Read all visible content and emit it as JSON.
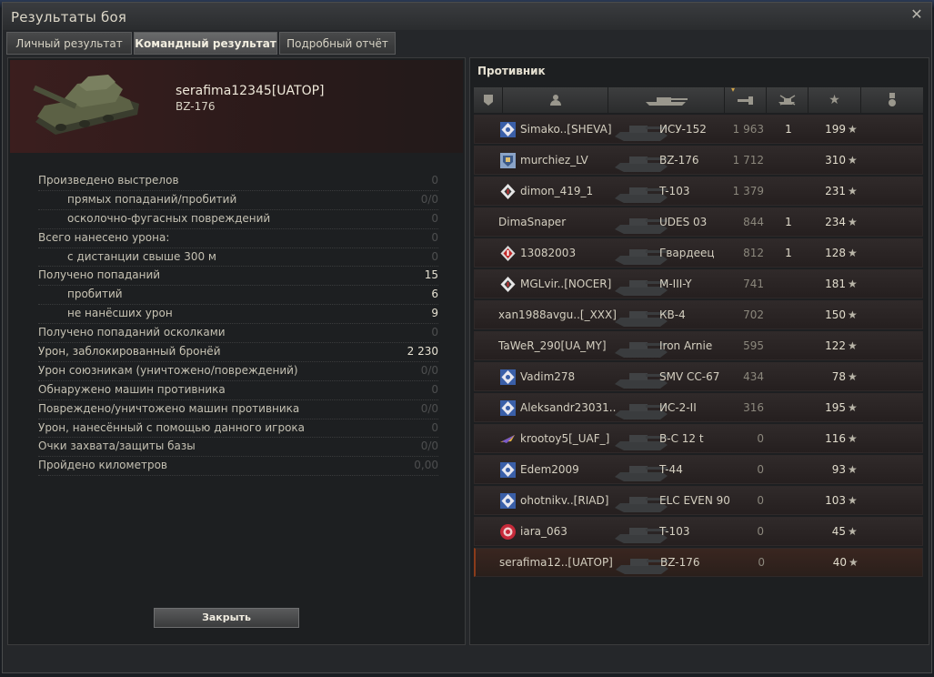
{
  "window": {
    "title": "Результаты боя",
    "close_symbol": "✕"
  },
  "tabs": [
    {
      "label": "Личный результат",
      "active": false
    },
    {
      "label": "Командный результат",
      "active": true
    },
    {
      "label": "Подробный отчёт",
      "active": false
    }
  ],
  "player": {
    "name": "serafima12345[UATOP]",
    "tank": "BZ-176"
  },
  "stats": [
    {
      "label": "Произведено выстрелов",
      "value": "0",
      "indent": false,
      "dim": true
    },
    {
      "label": "прямых попаданий/пробитий",
      "value": "0/0",
      "indent": true,
      "dim": true
    },
    {
      "label": "осколочно-фугасных повреждений",
      "value": "0",
      "indent": true,
      "dim": true
    },
    {
      "label": "Всего нанесено урона:",
      "value": "0",
      "indent": false,
      "dim": true
    },
    {
      "label": "с дистанции свыше 300 м",
      "value": "0",
      "indent": true,
      "dim": true
    },
    {
      "label": "Получено попаданий",
      "value": "15",
      "indent": false,
      "dim": false
    },
    {
      "label": "пробитий",
      "value": "6",
      "indent": true,
      "dim": false
    },
    {
      "label": "не нанёсших урон",
      "value": "9",
      "indent": true,
      "dim": false
    },
    {
      "label": "Получено попаданий осколками",
      "value": "0",
      "indent": false,
      "dim": true
    },
    {
      "label": "Урон, заблокированный бронёй",
      "value": "2 230",
      "indent": false,
      "dim": false
    },
    {
      "label": "Урон союзникам (уничтожено/повреждений)",
      "value": "0/0",
      "indent": false,
      "dim": true
    },
    {
      "label": "Обнаружено машин противника",
      "value": "0",
      "indent": false,
      "dim": true
    },
    {
      "label": "Повреждено/уничтожено машин противника",
      "value": "0/0",
      "indent": false,
      "dim": true
    },
    {
      "label": "Урон, нанесённый с помощью данного игрока",
      "value": "0",
      "indent": false,
      "dim": true
    },
    {
      "label": "Очки захвата/защиты базы",
      "value": "0/0",
      "indent": false,
      "dim": true
    },
    {
      "label": "Пройдено километров",
      "value": "0,00",
      "indent": false,
      "dim": true
    }
  ],
  "close_button": "Закрыть",
  "enemy": {
    "title": "Противник",
    "columns": [
      "squad",
      "player",
      "vehicle",
      "damage",
      "kills",
      "xp",
      "medals"
    ],
    "rows": [
      {
        "clan": "diamond-blue",
        "name": "Simako..[SHEVA]",
        "vehicle": "ИСУ-152",
        "damage": "1 963",
        "kills": "1",
        "xp": "199"
      },
      {
        "clan": "shield-blue",
        "name": "murchiez_LV",
        "vehicle": "BZ-176",
        "damage": "1 712",
        "kills": "",
        "xp": "310"
      },
      {
        "clan": "diamond-white",
        "name": "dimon_419_1",
        "vehicle": "T-103",
        "damage": "1 379",
        "kills": "",
        "xp": "231"
      },
      {
        "clan": "",
        "name": "DimaSnaper",
        "vehicle": "UDES 03",
        "damage": "844",
        "kills": "1",
        "xp": "234"
      },
      {
        "clan": "diamond-red",
        "name": "13082003",
        "vehicle": "Гвардеец",
        "damage": "812",
        "kills": "1",
        "xp": "128"
      },
      {
        "clan": "diamond-white",
        "name": "MGLvir..[NOCER]",
        "vehicle": "M-III-Y",
        "damage": "741",
        "kills": "",
        "xp": "181"
      },
      {
        "clan": "",
        "name": "xan1988avgu..[_XXX]",
        "vehicle": "КВ-4",
        "damage": "702",
        "kills": "",
        "xp": "150"
      },
      {
        "clan": "",
        "name": "TaWeR_290[UA_MY]",
        "vehicle": "Iron Arnie",
        "damage": "595",
        "kills": "",
        "xp": "122"
      },
      {
        "clan": "diamond-blue",
        "name": "Vadim278",
        "vehicle": "SMV CC-67",
        "damage": "434",
        "kills": "",
        "xp": "78"
      },
      {
        "clan": "diamond-blue",
        "name": "Aleksandr23031..",
        "vehicle": "ИС-2-II",
        "damage": "316",
        "kills": "",
        "xp": "195"
      },
      {
        "clan": "plane",
        "name": "krootoy5[_UAF_]",
        "vehicle": "B-C 12 t",
        "damage": "0",
        "kills": "",
        "xp": "116"
      },
      {
        "clan": "diamond-blue",
        "name": "Edem2009",
        "vehicle": "T-44",
        "damage": "0",
        "kills": "",
        "xp": "93"
      },
      {
        "clan": "diamond-blue",
        "name": "ohotnikv..[RIAD]",
        "vehicle": "ELC EVEN 90",
        "damage": "0",
        "kills": "",
        "xp": "103"
      },
      {
        "clan": "circle-red",
        "name": "iara_063",
        "vehicle": "T-103",
        "damage": "0",
        "kills": "",
        "xp": "45"
      },
      {
        "clan": "",
        "name": "serafima12..[UATOP]",
        "vehicle": "BZ-176",
        "damage": "0",
        "kills": "",
        "xp": "40",
        "me": true
      }
    ]
  }
}
